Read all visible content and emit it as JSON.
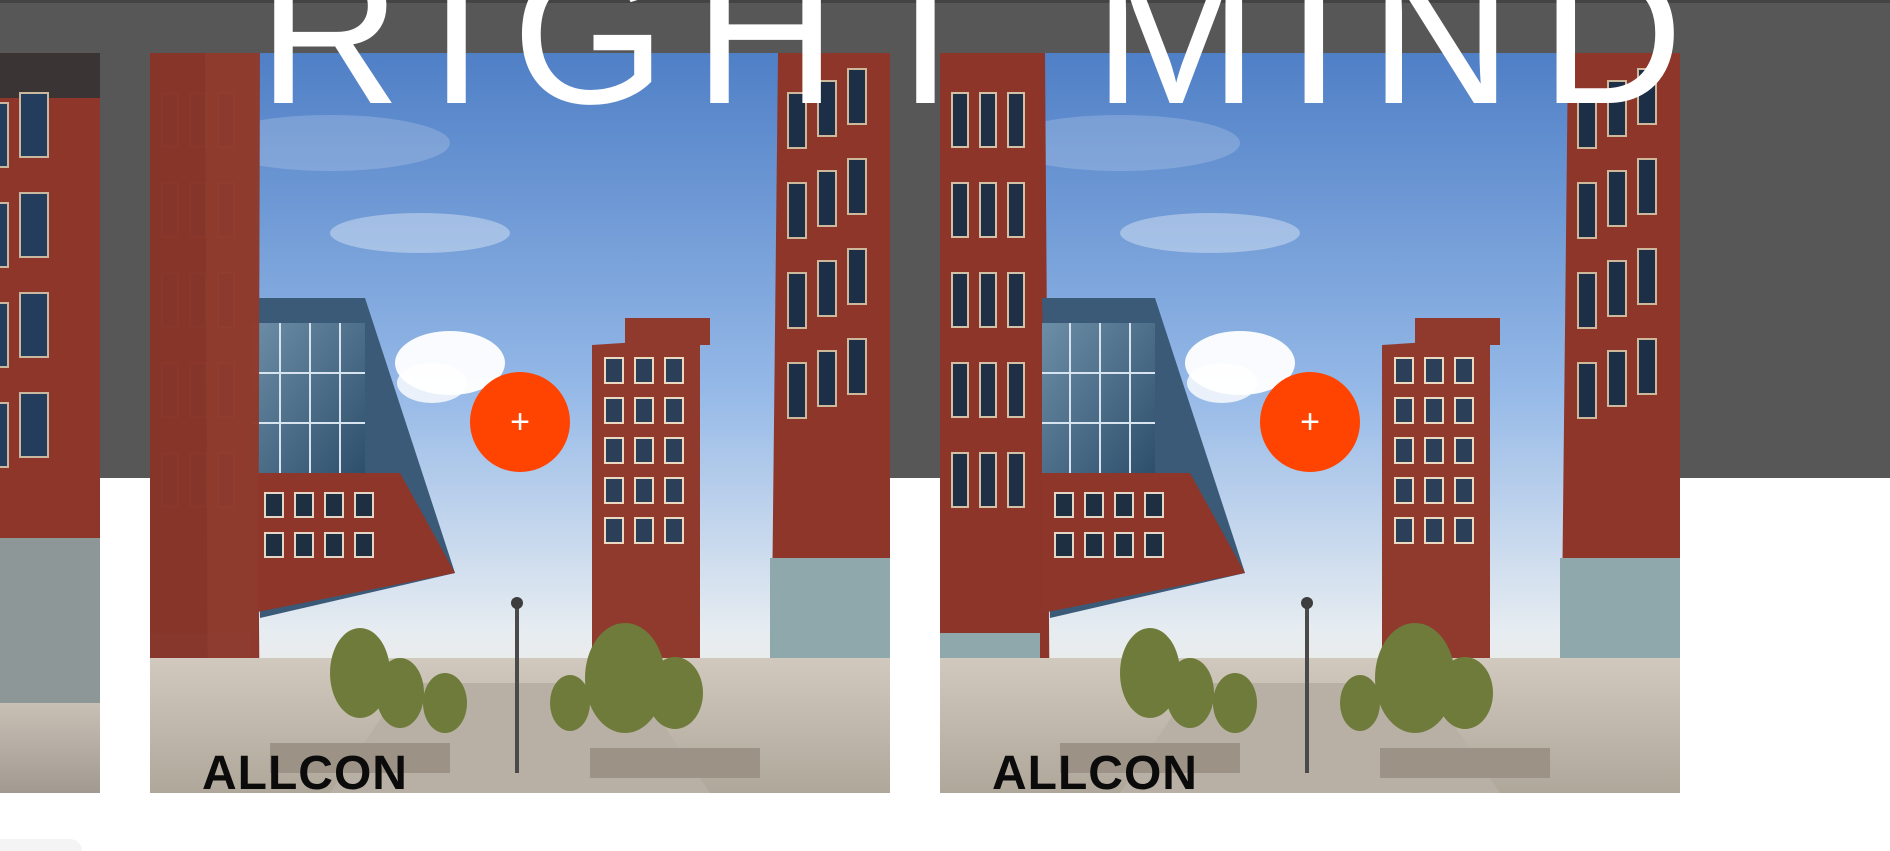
{
  "hero": {
    "headline": "RIGHT MIND"
  },
  "colors": {
    "band": "#575757",
    "accent": "#ff4300",
    "page": "#ffffff",
    "brick": "#8d3629",
    "glass": "#4b6f8c"
  },
  "cards": [
    {
      "brand": "ALLCON",
      "plus_label": "+",
      "icon": "plus-icon"
    },
    {
      "brand": "ALLCON",
      "plus_label": "+",
      "icon": "plus-icon"
    }
  ]
}
